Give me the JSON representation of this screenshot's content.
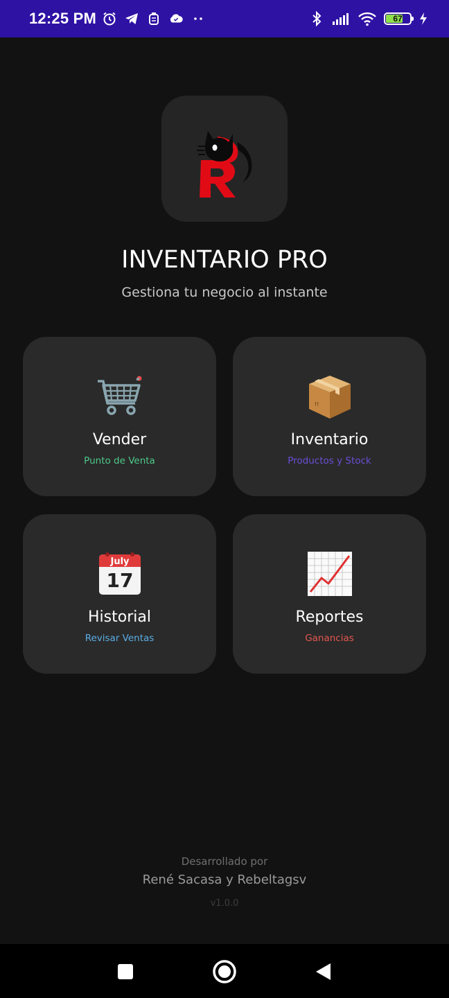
{
  "status_bar": {
    "time": "12:25 PM",
    "left_icons": [
      "alarm-icon",
      "telegram-icon",
      "shield-icon",
      "cloud-icon",
      "more-dots-icon"
    ],
    "right_icons": [
      "bluetooth-icon",
      "signal-icon",
      "wifi-icon",
      "battery-icon",
      "charging-icon"
    ],
    "battery_level": "67",
    "battery_fraction": 0.67,
    "background": "#2e12a4"
  },
  "header": {
    "logo_icon": "cat-r-logo-icon",
    "title": "INVENTARIO PRO",
    "subtitle": "Gestiona tu negocio al instante"
  },
  "menu": [
    {
      "icon": "shopping-cart-icon",
      "title": "Vender",
      "subtitle": "Punto de Venta",
      "subtitle_color": "#4ec98a"
    },
    {
      "icon": "package-box-icon",
      "title": "Inventario",
      "subtitle": "Productos y Stock",
      "subtitle_color": "#6a4fd6"
    },
    {
      "icon": "calendar-icon",
      "title": "Historial",
      "subtitle": "Revisar Ventas",
      "subtitle_color": "#5aaee6",
      "calendar_month": "July",
      "calendar_day": "17"
    },
    {
      "icon": "chart-up-icon",
      "title": "Reportes",
      "subtitle": "Ganancias",
      "subtitle_color": "#e3564f"
    }
  ],
  "footer": {
    "developed_by": "Desarrollado por",
    "authors": "René Sacasa y Rebeltagsv",
    "version": "v1.0.0"
  },
  "nav_bar": {
    "buttons": [
      "recent-apps-icon",
      "home-icon",
      "back-icon"
    ]
  }
}
